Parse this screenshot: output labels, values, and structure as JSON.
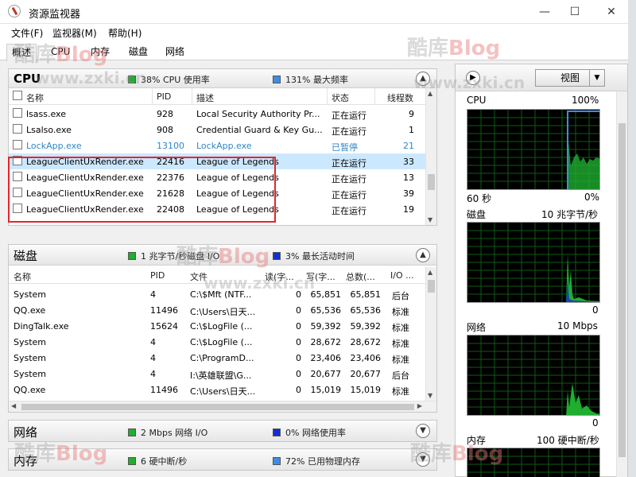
{
  "window": {
    "title": "资源监视器",
    "minimize": "—",
    "maximize": "☐",
    "close": "✕"
  },
  "menu": [
    "文件(F)",
    "监视器(M)",
    "帮助(H)"
  ],
  "tabs": [
    "概述",
    "CPU",
    "内存",
    "磁盘",
    "网络"
  ],
  "colors": {
    "green": "#1fae2f",
    "blue": "#3d8ee3",
    "darkblue": "#1030d0",
    "highlight": "#e3262c",
    "paused": "#2f86c8"
  },
  "cpu": {
    "title": "CPU",
    "stat1": "38% CPU 使用率",
    "stat2": "131% 最大频率",
    "headers": [
      "名称",
      "PID",
      "描述",
      "状态",
      "线程数"
    ],
    "rows": [
      {
        "name": "lsass.exe",
        "pid": "928",
        "desc": "Local Security Authority Pr...",
        "status": "正在运行",
        "threads": "9"
      },
      {
        "name": "Lsalso.exe",
        "pid": "908",
        "desc": "Credential Guard & Key Gu...",
        "status": "正在运行",
        "threads": "1"
      },
      {
        "name": "LockApp.exe",
        "pid": "13100",
        "desc": "LockApp.exe",
        "status": "已暂停",
        "threads": "21"
      },
      {
        "name": "LeagueClientUxRender.exe",
        "pid": "22416",
        "desc": "League of Legends",
        "status": "正在运行",
        "threads": "33"
      },
      {
        "name": "LeagueClientUxRender.exe",
        "pid": "22376",
        "desc": "League of Legends",
        "status": "正在运行",
        "threads": "13"
      },
      {
        "name": "LeagueClientUxRender.exe",
        "pid": "21628",
        "desc": "League of Legends",
        "status": "正在运行",
        "threads": "39"
      },
      {
        "name": "LeagueClientUxRender.exe",
        "pid": "22408",
        "desc": "League of Legends",
        "status": "正在运行",
        "threads": "19"
      }
    ]
  },
  "disk": {
    "title": "磁盘",
    "stat1": "1 兆字节/秒磁盘 I/O",
    "stat2": "3% 最长活动时间",
    "headers": [
      "名称",
      "PID",
      "文件",
      "读(字...",
      "写(字...",
      "总数(...",
      "I/O ..."
    ],
    "rows": [
      {
        "name": "System",
        "pid": "4",
        "file": "C:\\$Mft (NTF...",
        "read": "0",
        "write": "65,851",
        "total": "65,851",
        "io": "后台"
      },
      {
        "name": "QQ.exe",
        "pid": "11496",
        "file": "C:\\Users\\日天...",
        "read": "0",
        "write": "65,536",
        "total": "65,536",
        "io": "标准"
      },
      {
        "name": "DingTalk.exe",
        "pid": "15624",
        "file": "C:\\$LogFile (...",
        "read": "0",
        "write": "59,392",
        "total": "59,392",
        "io": "标准"
      },
      {
        "name": "System",
        "pid": "4",
        "file": "C:\\$LogFile (...",
        "read": "0",
        "write": "28,672",
        "total": "28,672",
        "io": "标准"
      },
      {
        "name": "System",
        "pid": "4",
        "file": "C:\\ProgramD...",
        "read": "0",
        "write": "23,406",
        "total": "23,406",
        "io": "标准"
      },
      {
        "name": "System",
        "pid": "4",
        "file": "I:\\英雄联盟\\G...",
        "read": "0",
        "write": "20,677",
        "total": "20,677",
        "io": "后台"
      },
      {
        "name": "QQ.exe",
        "pid": "11496",
        "file": "C:\\Users\\日天...",
        "read": "0",
        "write": "15,019",
        "total": "15,019",
        "io": "标准"
      }
    ]
  },
  "network": {
    "title": "网络",
    "stat1": "2 Mbps 网络 I/O",
    "stat2": "0% 网络使用率"
  },
  "memory": {
    "title": "内存",
    "stat1": "6 硬中断/秒",
    "stat2": "72% 已用物理内存"
  },
  "right_panel": {
    "view_button": "视图",
    "graphs": [
      {
        "label": "CPU",
        "right": "100%",
        "bottom_left": "60 秒",
        "bottom_right": "0%"
      },
      {
        "label": "磁盘",
        "right": "10 兆字节/秒",
        "bottom_left": "",
        "bottom_right": "0"
      },
      {
        "label": "网络",
        "right": "10 Mbps",
        "bottom_left": "",
        "bottom_right": "0"
      },
      {
        "label": "内存",
        "right": "100 硬中断/秒",
        "bottom_left": "",
        "bottom_right": ""
      }
    ]
  },
  "watermark": {
    "text1": "酷库",
    "text2": "Blog",
    "url": "www.zxki.cn"
  }
}
